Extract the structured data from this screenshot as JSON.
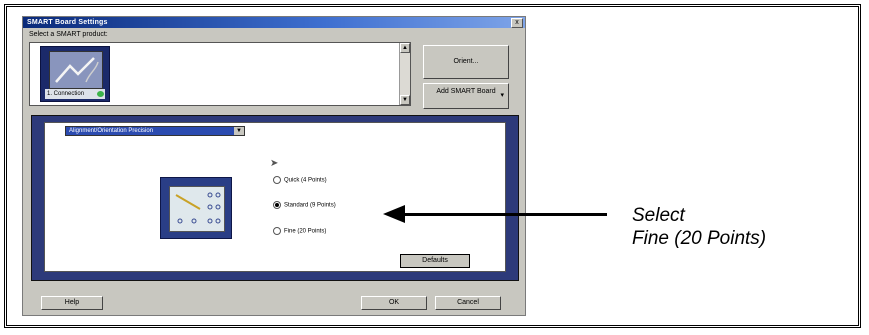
{
  "dialog": {
    "title": "SMART Board Settings",
    "close_label": "x",
    "select_label": "Select a SMART product:",
    "product": {
      "caption": "1. Connection"
    },
    "orient_button": "Orient...",
    "add_button": "Add SMART Board",
    "settings": {
      "combo_value": "Alignment/Orientation Precision",
      "options": [
        {
          "label": "Quick (4 Points)",
          "selected": false
        },
        {
          "label": "Standard (9 Points)",
          "selected": true
        },
        {
          "label": "Fine (20 Points)",
          "selected": false
        }
      ],
      "defaults_button": "Defaults"
    },
    "help_button": "Help",
    "ok_button": "OK",
    "cancel_button": "Cancel"
  },
  "callout": {
    "line1": "Select",
    "line2": "Fine (20 Points)"
  }
}
